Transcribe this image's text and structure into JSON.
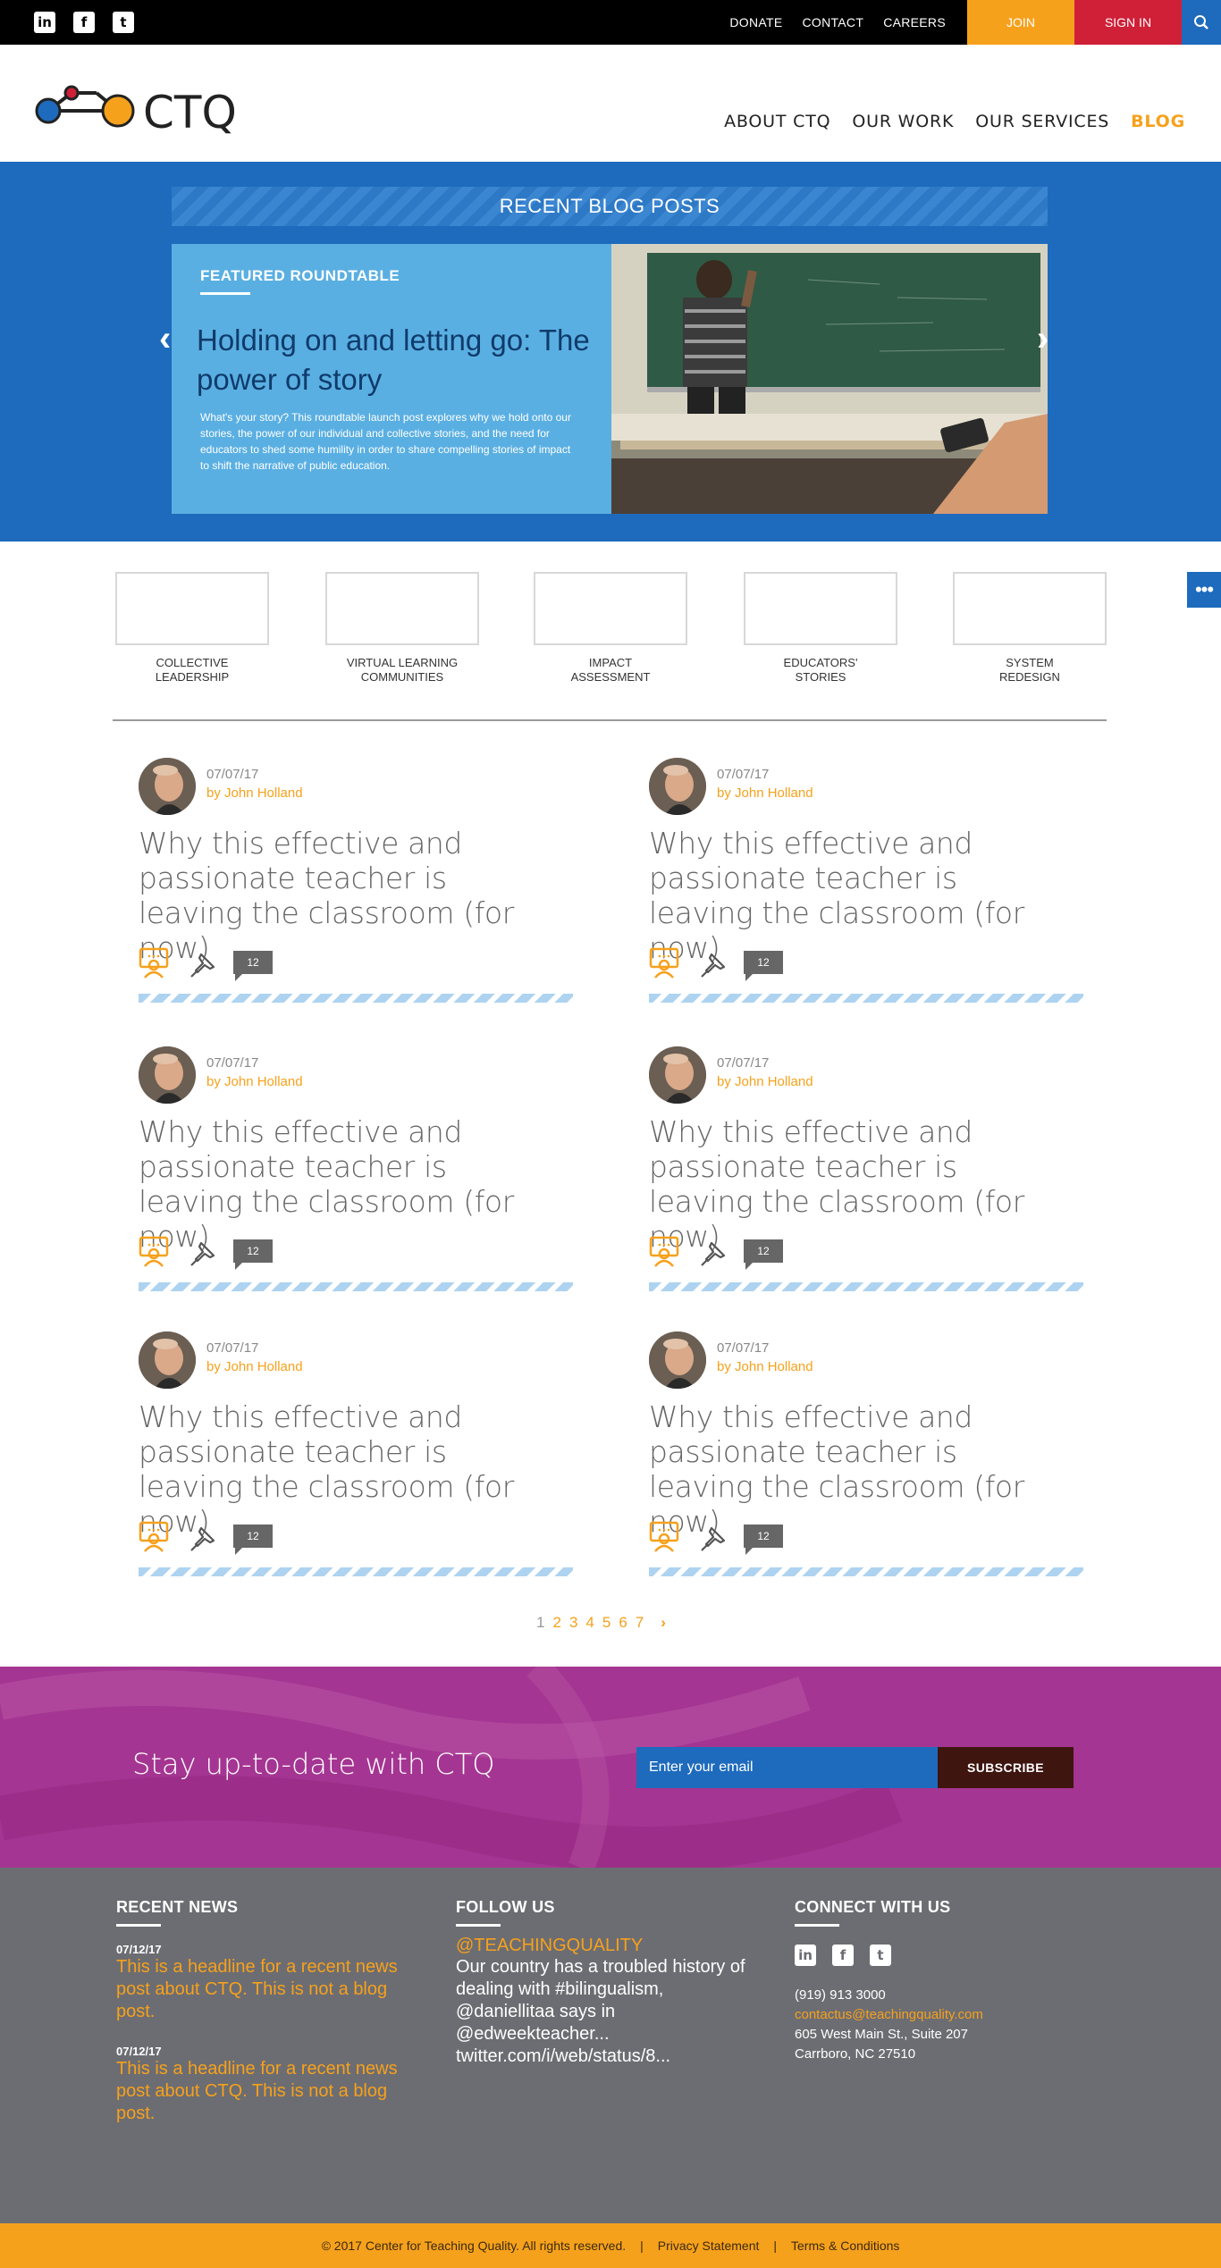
{
  "topbar": {
    "social": [
      "in",
      "f",
      "t"
    ],
    "links": [
      "DONATE",
      "CONTACT",
      "CAREERS"
    ],
    "join_label": "JOIN",
    "signin_label": "SIGN IN"
  },
  "header": {
    "logo_text": "CTQ",
    "nav": [
      "ABOUT CTQ",
      "OUR WORK",
      "OUR SERVICES",
      "BLOG"
    ],
    "active": "BLOG"
  },
  "hero": {
    "section_title": "RECENT BLOG POSTS",
    "label": "FEATURED ROUNDTABLE",
    "headline": "Holding on and letting go: The power of story",
    "excerpt": "What's your story? This roundtable launch post explores why we hold onto our stories, the power of our individual and collective stories, and the need for educators to shed some humility in order to share compelling stories of impact to shift the narrative of public education."
  },
  "categories": [
    {
      "line1": "COLLECTIVE",
      "line2": "LEADERSHIP"
    },
    {
      "line1": "VIRTUAL LEARNING",
      "line2": "COMMUNITIES"
    },
    {
      "line1": "IMPACT",
      "line2": "ASSESSMENT"
    },
    {
      "line1": "EDUCATORS'",
      "line2": "STORIES"
    },
    {
      "line1": "SYSTEM",
      "line2": "REDESIGN"
    }
  ],
  "posts": [
    {
      "date": "07/07/17",
      "author": "by John Holland",
      "title": "Why this effective and passionate teacher is leaving the classroom (for now)",
      "comments": "12"
    },
    {
      "date": "07/07/17",
      "author": "by John Holland",
      "title": "Why this effective and passionate teacher is leaving the classroom (for now)",
      "comments": "12"
    },
    {
      "date": "07/07/17",
      "author": "by John Holland",
      "title": "Why this effective and passionate teacher is leaving the classroom (for now)",
      "comments": "12"
    },
    {
      "date": "07/07/17",
      "author": "by John Holland",
      "title": "Why this effective and passionate teacher is leaving the classroom (for now)",
      "comments": "12"
    },
    {
      "date": "07/07/17",
      "author": "by John Holland",
      "title": "Why this effective and passionate teacher is leaving the classroom (for now)",
      "comments": "12"
    },
    {
      "date": "07/07/17",
      "author": "by John Holland",
      "title": "Why this effective and passionate teacher is leaving the classroom (for now)",
      "comments": "12"
    }
  ],
  "pagination": {
    "pages": [
      "1",
      "2",
      "3",
      "4",
      "5",
      "6",
      "7"
    ],
    "current": "1",
    "next": "›"
  },
  "newsletter": {
    "text": "Stay up-to-date with CTQ",
    "placeholder": "Enter your email",
    "button": "SUBSCRIBE"
  },
  "footer": {
    "recent_news": {
      "heading": "RECENT NEWS",
      "items": [
        {
          "date": "07/12/17",
          "text": "This is a headline for a recent news post about CTQ. This is not a blog post."
        },
        {
          "date": "07/12/17",
          "text": "This is a headline for a recent news post about CTQ. This is not a blog post."
        }
      ]
    },
    "follow": {
      "heading": "FOLLOW US",
      "handle": "@TEACHINGQUALITY",
      "tweet": "Our country has a troubled history of dealing with #bilingualism, @daniellitaa says in @edweekteacher... twitter.com/i/web/status/8..."
    },
    "connect": {
      "heading": "CONNECT WITH US",
      "social": [
        "in",
        "f",
        "t"
      ],
      "phone": "(919) 913 3000",
      "email": "contactus@teachingquality.com",
      "address1": "605 West Main St., Suite 207",
      "address2": "Carrboro, NC 27510"
    }
  },
  "bottom": {
    "copyright": "© 2017 Center for Teaching Quality. All rights reserved.",
    "sep": "|",
    "privacy": "Privacy Statement",
    "terms": "Terms & Conditions"
  },
  "colors": {
    "orange": "#f6a11c",
    "blue": "#1e6bbd",
    "red": "#cf2037",
    "purple": "#a53592",
    "footer_gray": "#6c6d72"
  }
}
